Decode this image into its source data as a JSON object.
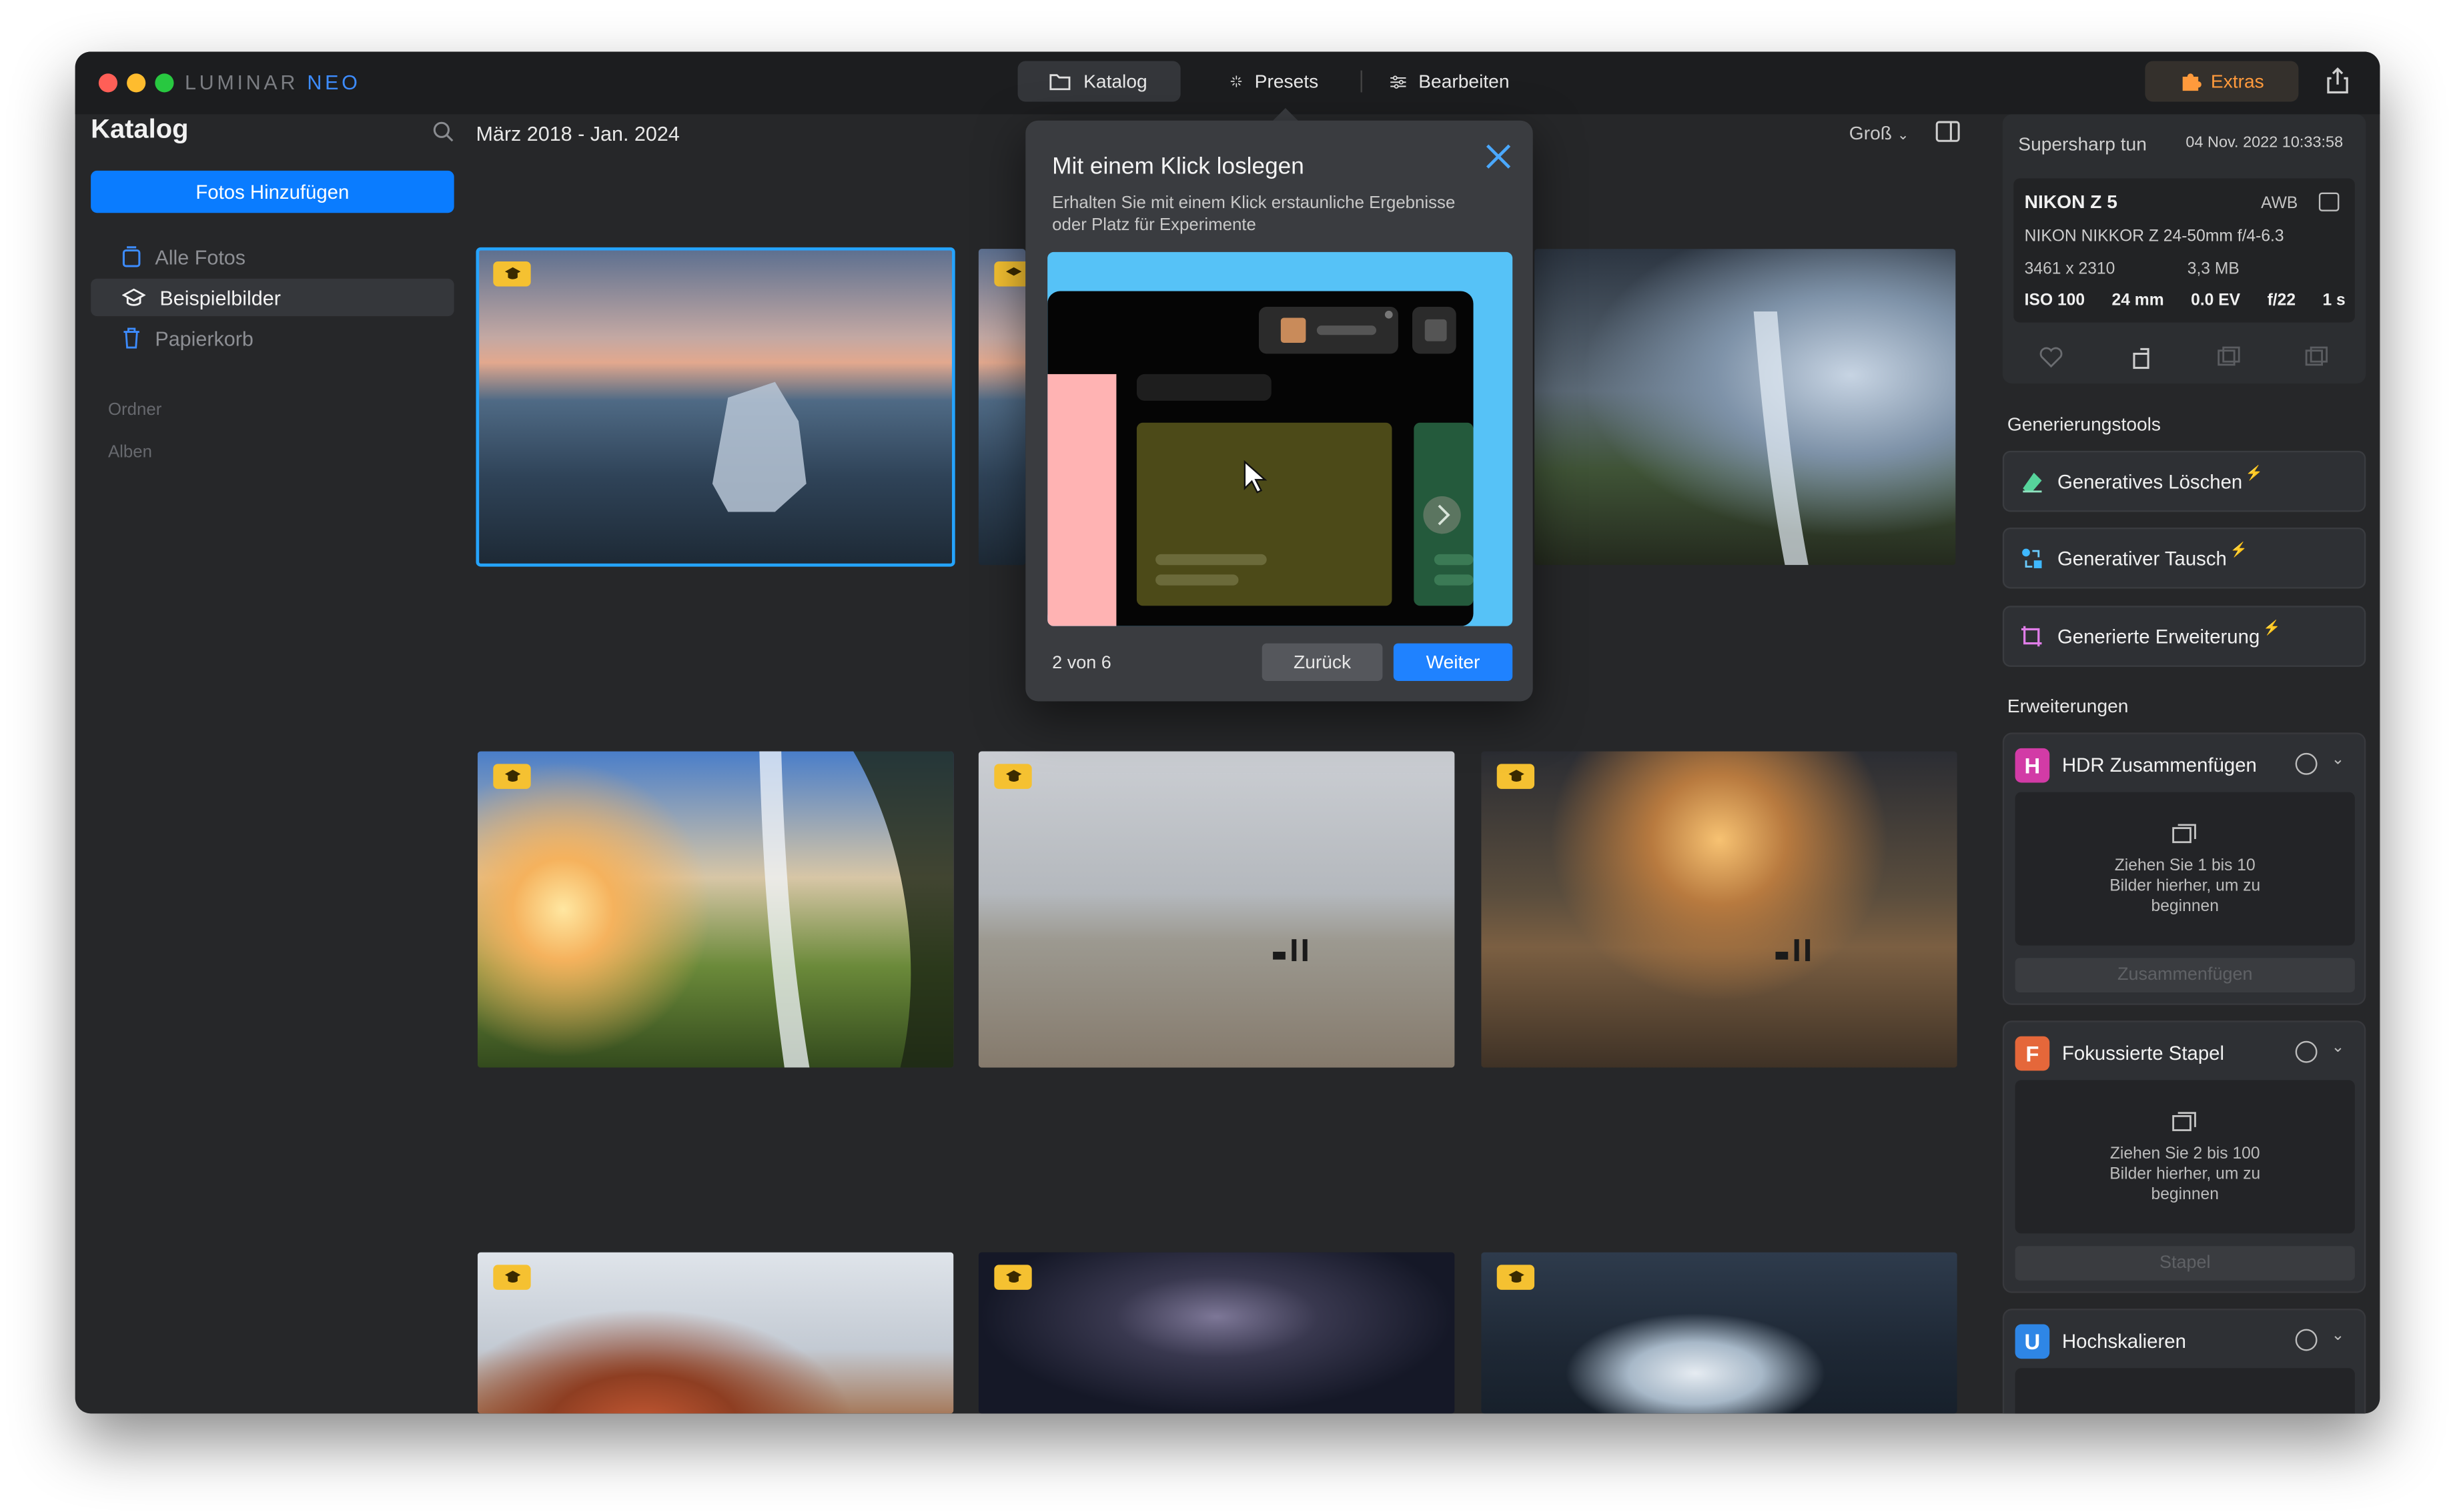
{
  "app": {
    "brand_main": "LUMINAR",
    "brand_accent": "NEO"
  },
  "topnav": {
    "katalog": "Katalog",
    "presets": "Presets",
    "bearbeiten": "Bearbeiten",
    "extras": "Extras"
  },
  "sidebar": {
    "title": "Katalog",
    "add_button": "Fotos Hinzufügen",
    "items": [
      {
        "label": "Alle Fotos"
      },
      {
        "label": "Beispielbilder"
      },
      {
        "label": "Papierkorb"
      }
    ],
    "section_folders": "Ordner",
    "section_albums": "Alben"
  },
  "gallery": {
    "range": "März 2018 - Jan. 2024",
    "size": "Groß"
  },
  "popup": {
    "title": "Mit einem Klick loslegen",
    "description": "Erhalten Sie mit einem Klick erstaunliche Ergebnisse oder Platz für Experimente",
    "step": "2 von 6",
    "back": "Zurück",
    "next": "Weiter"
  },
  "info": {
    "preset": "Supersharp tun",
    "date": "04 Nov. 2022 10:33:58",
    "camera": "NIKON Z 5",
    "wb": "AWB",
    "lens": "NIKON NIKKOR Z 24-50mm f/4-6.3",
    "dimensions": "3461 x 2310",
    "filesize": "3,3 MB",
    "iso": "ISO 100",
    "focal": "24 mm",
    "ev": "0.0 EV",
    "aperture": "f/22",
    "shutter": "1 s"
  },
  "gen_tools": {
    "heading": "Generierungstools",
    "erase": "Generatives Löschen",
    "swap": "Generativer Tausch",
    "expand": "Generierte Erweiterung"
  },
  "extensions": {
    "heading": "Erweiterungen",
    "hdr": {
      "letter": "H",
      "title": "HDR Zusammenfügen",
      "hint": "Ziehen Sie 1 bis 10 Bilder hierher, um zu beginnen",
      "action": "Zusammenfügen"
    },
    "focus": {
      "letter": "F",
      "title": "Fokussierte Stapel",
      "hint": "Ziehen Sie 2 bis 100 Bilder hierher, um zu beginnen",
      "action": "Stapel"
    },
    "upscale": {
      "letter": "U",
      "title": "Hochskalieren"
    }
  },
  "colors": {
    "accent": "#0a7cff",
    "extras": "#ff9a3c",
    "selection": "#25a4ff",
    "badge": "#f5c131"
  }
}
